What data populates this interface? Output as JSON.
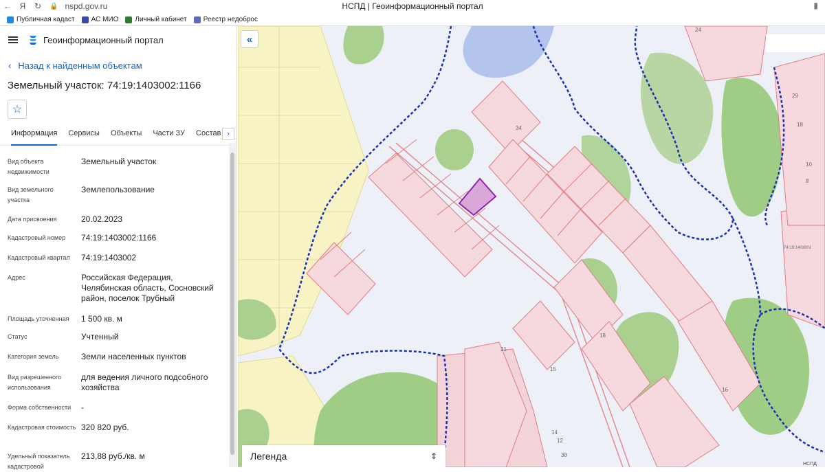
{
  "browser": {
    "url": "nspd.gov.ru",
    "page_title": "НСПД | Геоинформационный портал",
    "bookmarks": [
      {
        "label": "Публичная кадаст",
        "color": "#1e88e5"
      },
      {
        "label": "АС МИО",
        "color": "#3949ab"
      },
      {
        "label": "Личный кабинет",
        "color": "#2e7d32"
      },
      {
        "label": "Реестр недоброс",
        "color": "#5c6bc0"
      }
    ]
  },
  "app": {
    "name": "Геоинформационный портал",
    "back_label": "Назад к найденным объектам",
    "object_title": "Земельный участок: 74:19:1403002:1166",
    "accent_color": "#1565c0"
  },
  "tabs": [
    {
      "label": "Информация",
      "active": true
    },
    {
      "label": "Сервисы",
      "active": false
    },
    {
      "label": "Объекты",
      "active": false
    },
    {
      "label": "Части ЗУ",
      "active": false
    },
    {
      "label": "Состав",
      "active": false
    }
  ],
  "info": [
    {
      "label": "Вид объекта недвижимости",
      "value": "Земельный участок"
    },
    {
      "label": "Вид земельного участка",
      "value": "Землепользование"
    },
    {
      "label": "Дата присвоения",
      "value": "20.02.2023"
    },
    {
      "label": "Кадастровый номер",
      "value": "74:19:1403002:1166"
    },
    {
      "label": "Кадастровый квартал",
      "value": "74:19:1403002"
    },
    {
      "label": "Адрес",
      "value": "Российская Федерация, Челябинская область, Сосновский район, поселок Трубный"
    },
    {
      "label": "Площадь уточненная",
      "value": "1 500 кв. м"
    },
    {
      "label": "Статус",
      "value": "Учтенный"
    },
    {
      "label": "Категория земель",
      "value": "Земли населенных пунктов"
    },
    {
      "label": "Вид разрешенного использования",
      "value": "для ведения личного подсобного хозяйства"
    },
    {
      "label": "Форма собственности",
      "value": "-"
    },
    {
      "label": "Кадастровая стоимость",
      "value": "320 820 руб."
    },
    {
      "label": "Удельный показатель кадастровой",
      "value": "213,88 руб./кв. м"
    }
  ],
  "map": {
    "legend_label": "Легенда",
    "labels": [
      "24",
      "34",
      "21",
      "15",
      "14",
      "12",
      "38",
      "18",
      "29",
      "18",
      "10",
      "8",
      "16",
      "74:19:1403001",
      "НСПД"
    ]
  }
}
